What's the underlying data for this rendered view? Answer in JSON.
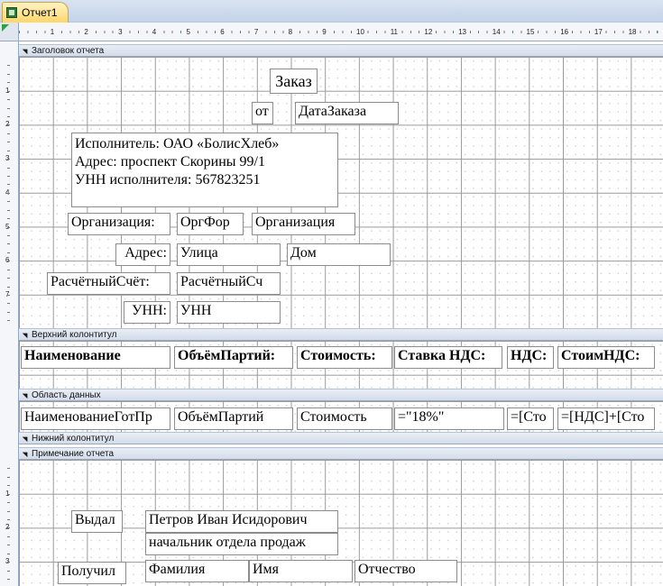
{
  "tab": {
    "label": "Отчет1"
  },
  "ruler": {
    "h_numbers": [
      "1",
      "2",
      "3",
      "4",
      "5",
      "6",
      "7",
      "8",
      "9",
      "10",
      "11",
      "12",
      "13",
      "14",
      "15",
      "16",
      "17",
      "18"
    ],
    "v_head": [
      "1",
      "2",
      "3",
      "4",
      "5",
      "6",
      "7"
    ],
    "v_foot": [
      "1",
      "2",
      "3"
    ]
  },
  "sections": {
    "report_header": "Заголовок отчета",
    "page_header": "Верхний колонтитул",
    "detail": "Область данных",
    "page_footer": "Нижний колонтитул",
    "report_footer": "Примечание отчета"
  },
  "report_header": {
    "title": "Заказ",
    "from_label": "от",
    "date_field": "ДатаЗаказа",
    "executor_lines": [
      "Исполнитель: ОАО «БолисХлеб»",
      "Адрес: проспект Скорины 99/1",
      "УНН исполнителя: 567823251"
    ],
    "org_label": "Организация:",
    "org_form_field": "ОргФор",
    "org_field": "Организация",
    "address_label": "Адрес:",
    "street_field": "Улица",
    "house_field": "Дом",
    "account_label": "РасчётныйСчёт:",
    "account_field": "РасчётныйСч",
    "unn_label": "УНН:",
    "unn_field": "УНН"
  },
  "page_header": {
    "columns": [
      "Наименование",
      "ОбъёмПартий:",
      "Стоимость:",
      "Ставка НДС:",
      "НДС:",
      "СтоимНДС:"
    ]
  },
  "detail": {
    "fields": [
      "НаименованиеГотПр",
      "ОбъёмПартий",
      "Стоимость",
      "=\"18%\"",
      "=[Сто",
      "=[НДС]+[Сто"
    ]
  },
  "report_footer": {
    "issued_label": "Выдал",
    "issuer_name": "Петров Иван Исидорович",
    "issuer_position": "начальник отдела продаж",
    "received_label": "Получил",
    "surname_field": "Фамилия",
    "name_field": "Имя",
    "patronymic_field": "Отчество"
  }
}
